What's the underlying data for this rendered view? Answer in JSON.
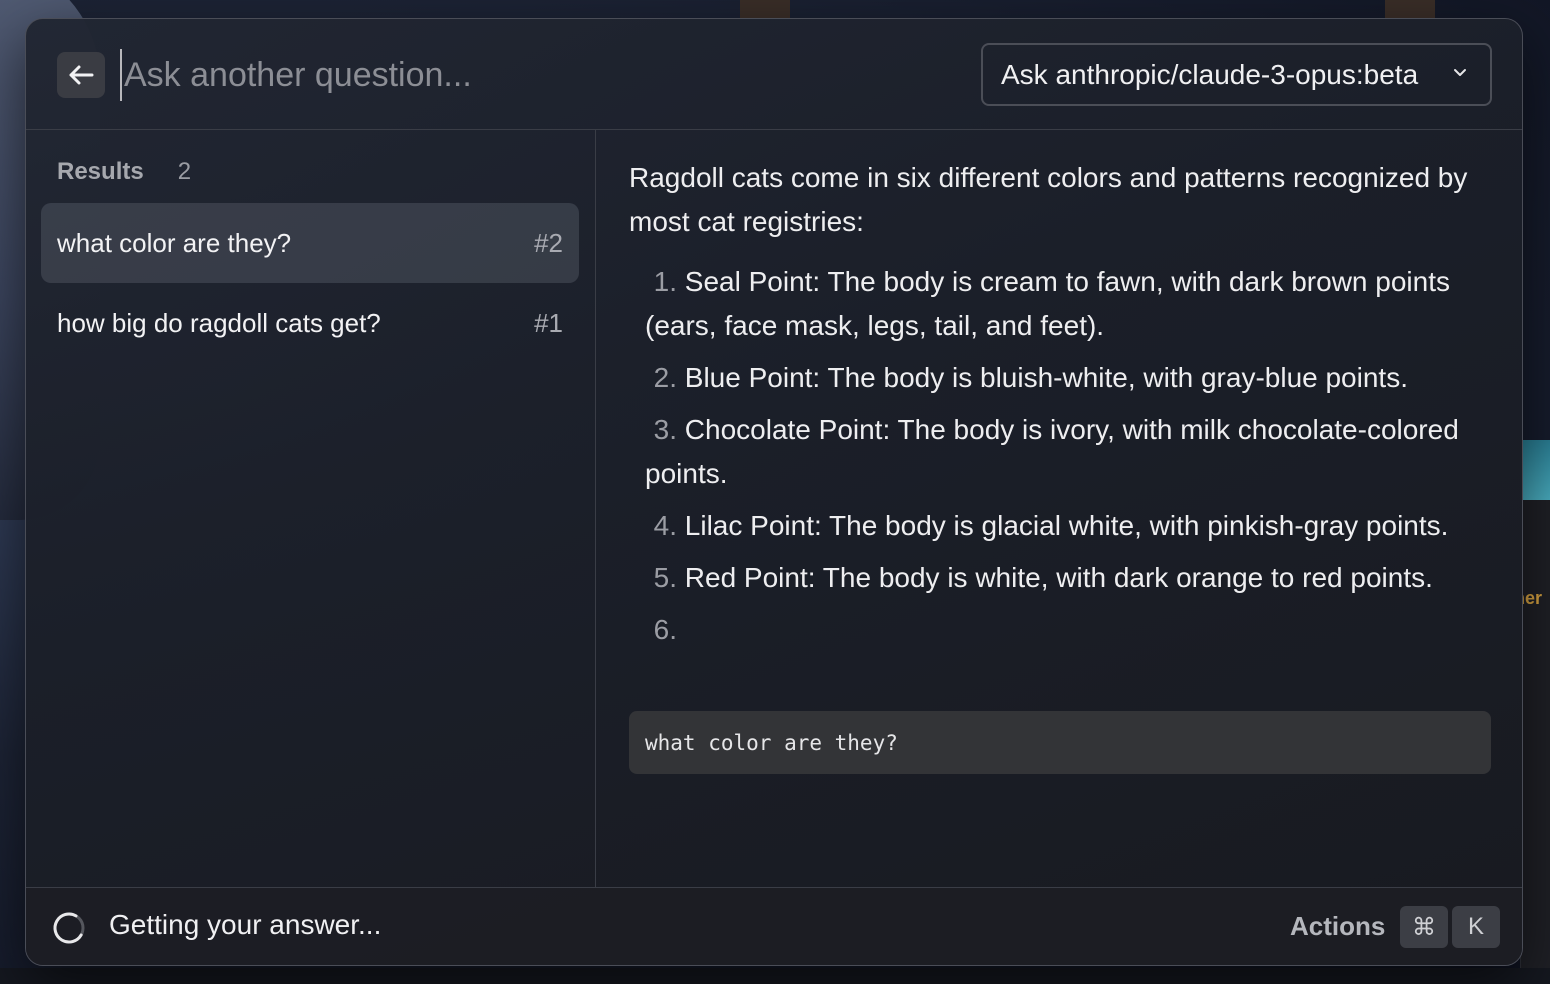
{
  "search": {
    "placeholder": "Ask another question..."
  },
  "model_select": {
    "label": "Ask anthropic/claude-3-opus:beta"
  },
  "results": {
    "label": "Results",
    "count": "2",
    "items": [
      {
        "text": "what color are they?",
        "num": "#2",
        "selected": true
      },
      {
        "text": "how big do ragdoll cats get?",
        "num": "#1",
        "selected": false
      }
    ]
  },
  "answer": {
    "intro": "Ragdoll cats come in six different colors and patterns recognized by most cat registries:",
    "items": [
      {
        "n": "1.",
        "text": "Seal Point: The body is cream to fawn, with dark brown points (ears, face mask, legs, tail, and feet)."
      },
      {
        "n": "2.",
        "text": "Blue Point: The body is bluish-white, with gray-blue points."
      },
      {
        "n": "3.",
        "text": "Chocolate Point: The body is ivory, with milk chocolate-colored points."
      },
      {
        "n": "4.",
        "text": "Lilac Point: The body is glacial white, with pinkish-gray points."
      },
      {
        "n": "5.",
        "text": "Red Point: The body is white, with dark orange to red points."
      },
      {
        "n": "6.",
        "text": ""
      }
    ],
    "code": "what color are they?"
  },
  "footer": {
    "status": "Getting your answer...",
    "actions_label": "Actions",
    "shortcut_cmd": "⌘",
    "shortcut_key": "K"
  },
  "background": {
    "partial_text": "her"
  },
  "colors": {
    "window_bg": "#1b1f29",
    "selected_bg": "#44474f",
    "accent_text": "#d9a441"
  }
}
